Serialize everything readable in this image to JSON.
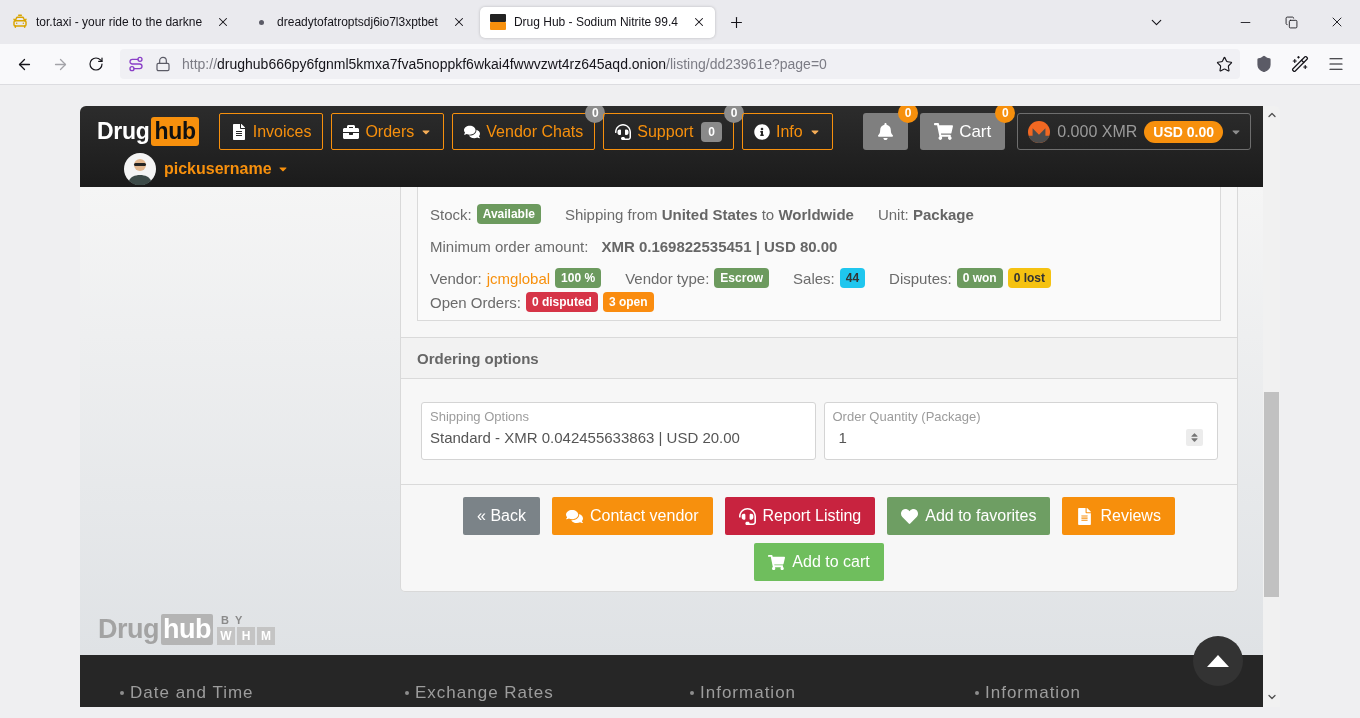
{
  "browser": {
    "tabs": [
      {
        "title": "tor.taxi - your ride to the darkne",
        "selected": false
      },
      {
        "title": "dreadytofatroptsdj6io7l3xptbet",
        "selected": false
      },
      {
        "title": "Drug Hub - Sodium Nitrite 99.4",
        "selected": true
      }
    ],
    "address": {
      "scheme": "http://",
      "host": "drughub666py6fgnml5kmxa7fva5noppkf6wkai4fwwvzwt4rz645aqd.onion",
      "path": "/listing/dd23961e?page=0"
    }
  },
  "header": {
    "logo": {
      "word": "Drug",
      "highlight": "hub"
    },
    "nav": [
      {
        "label": "Invoices",
        "dropdown": false
      },
      {
        "label": "Orders",
        "dropdown": true
      },
      {
        "label": "Vendor Chats",
        "dropdown": false,
        "badge": "0"
      },
      {
        "label": "Support",
        "dropdown": false,
        "count": "0",
        "badge": "0"
      },
      {
        "label": "Info",
        "dropdown": true
      }
    ],
    "notifications": {
      "badge": "0"
    },
    "cart": {
      "label": "Cart",
      "badge": "0"
    },
    "wallet": {
      "balance": "0.000 XMR",
      "fiat": "USD 0.00",
      "dropdown": true
    },
    "user": {
      "name": "pickusername",
      "dropdown": true
    }
  },
  "listing": {
    "details": [
      [
        [
          {
            "kind": "label",
            "text": "Stock:"
          },
          {
            "kind": "badge",
            "text": "Available",
            "color": "#6c9a5e"
          }
        ],
        [
          {
            "kind": "label",
            "text": "Shipping from **United States** to **Worldwide**"
          }
        ],
        [
          {
            "kind": "label",
            "text": "Unit: **Package**"
          }
        ]
      ],
      [
        [
          {
            "kind": "label",
            "text": "Minimum order amount:"
          },
          {
            "kind": "value",
            "text": "XMR 0.169822535451 | USD 80.00"
          }
        ]
      ],
      [
        [
          {
            "kind": "label",
            "text": "Vendor:"
          },
          {
            "kind": "link",
            "text": "jcmglobal"
          },
          {
            "kind": "badge",
            "text": "100 %",
            "color": "#6c9a5e"
          }
        ],
        [
          {
            "kind": "label",
            "text": "Vendor type:"
          },
          {
            "kind": "badge",
            "text": "Escrow",
            "color": "#6c9a5e"
          }
        ],
        [
          {
            "kind": "label",
            "text": "Sales:"
          },
          {
            "kind": "badge",
            "text": "44",
            "color": "#1fc6ee"
          }
        ],
        [
          {
            "kind": "label",
            "text": "Disputes:"
          },
          {
            "kind": "badge",
            "text": "0 won",
            "color": "#6c9a5e"
          },
          {
            "kind": "badge",
            "text": "0 lost",
            "color": "#f5c211"
          }
        ],
        [
          {
            "kind": "label",
            "text": "Open Orders:"
          },
          {
            "kind": "badge",
            "text": "0 disputed",
            "color": "#d63447"
          },
          {
            "kind": "badge",
            "text": "3 open",
            "color": "#fa8c0f"
          }
        ]
      ]
    ]
  },
  "ordering": {
    "title": "Ordering options",
    "fields": [
      {
        "kind": "select",
        "label": "Shipping Options",
        "value": "Standard - XMR 0.042455633863 | USD 20.00"
      },
      {
        "kind": "number",
        "label": "Order Quantity (Package)",
        "value": "1"
      }
    ]
  },
  "actions": [
    {
      "label": "« Back",
      "color": "#7b8388"
    },
    {
      "label": "Contact vendor",
      "color": "#f7900d"
    },
    {
      "label": "Report Listing",
      "color": "#c8233f"
    },
    {
      "label": "Add to favorites",
      "color": "#6e9e63"
    },
    {
      "label": "Reviews",
      "color": "#f78f0c"
    },
    {
      "label": "Add to cart",
      "color": "#6fbe5d"
    }
  ],
  "footer": {
    "logo": {
      "word": "Drug",
      "highlight": "hub",
      "by": "BY",
      "maker": [
        "W",
        "H",
        "M"
      ]
    },
    "columns": [
      "Date and Time",
      "Exchange Rates",
      "Information",
      "Information"
    ]
  }
}
